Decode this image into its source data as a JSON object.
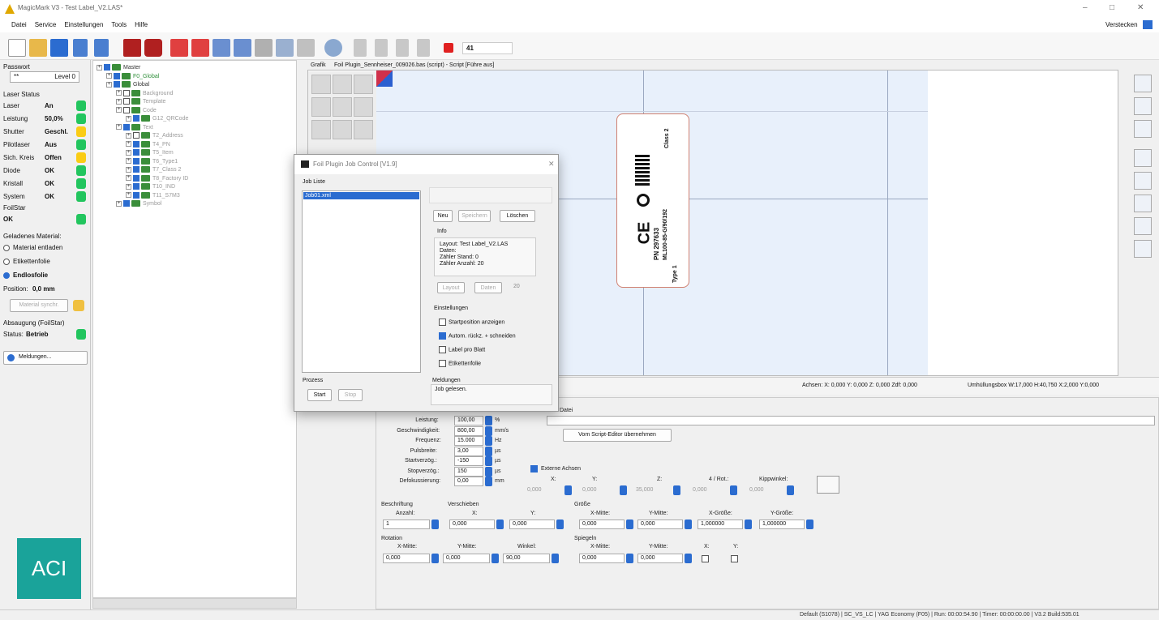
{
  "window": {
    "title": "MagicMark V3 - Test Label_V2.LAS*",
    "minimize": "–",
    "maximize": "□",
    "close": "✕"
  },
  "menu": {
    "items": [
      "Datei",
      "Service",
      "Einstellungen",
      "Tools",
      "Hilfe"
    ],
    "hide": "Verstecken"
  },
  "toolbar": {
    "counter": "41"
  },
  "left": {
    "password_label": "Passwort",
    "password_value": "**",
    "level": "Level 0",
    "laser_status_title": "Laser Status",
    "status_rows": [
      {
        "label": "Laser",
        "value": "An",
        "color": "green"
      },
      {
        "label": "Leistung",
        "value": "50,0%",
        "color": "green"
      },
      {
        "label": "Shutter",
        "value": "Geschl.",
        "color": "yellow"
      },
      {
        "label": "Pilotlaser",
        "value": "Aus",
        "color": "green"
      },
      {
        "label": "Sich. Kreis",
        "value": "Offen",
        "color": "yellow"
      },
      {
        "label": "Diode",
        "value": "OK",
        "color": "green"
      },
      {
        "label": "Kristall",
        "value": "OK",
        "color": "green"
      },
      {
        "label": "System",
        "value": "OK",
        "color": "green"
      }
    ],
    "foilstar_title": "FoilStar",
    "foilstar_value": "OK",
    "material_title": "Geladenes Material:",
    "material_options": [
      "Material entladen",
      "Etikettenfolie",
      "Endlosfolie"
    ],
    "position_label": "Position:",
    "position_value": "0,0 mm",
    "material_sync": "Material synchr.",
    "absaugung_title": "Absaugung (FoilStar)",
    "status_label": "Status:",
    "status_value": "Betrieb",
    "messages": "Meldungen...",
    "logo": "ACI"
  },
  "tree": {
    "items": [
      {
        "label": "Master",
        "indent": 0,
        "style": "normal",
        "checked": true
      },
      {
        "label": "F0_Global",
        "indent": 1,
        "style": "green",
        "checked": true
      },
      {
        "label": "Global",
        "indent": 1,
        "style": "normal",
        "checked": true
      },
      {
        "label": "Background",
        "indent": 2,
        "style": "dim",
        "checked": false
      },
      {
        "label": "Template",
        "indent": 2,
        "style": "dim",
        "checked": false
      },
      {
        "label": "Code",
        "indent": 2,
        "style": "dim",
        "checked": false
      },
      {
        "label": "G12_QRCode",
        "indent": 3,
        "style": "dim",
        "checked": true
      },
      {
        "label": "Text",
        "indent": 2,
        "style": "dim",
        "checked": true
      },
      {
        "label": "T2_Address",
        "indent": 3,
        "style": "dim",
        "checked": false
      },
      {
        "label": "T4_PN",
        "indent": 3,
        "style": "dim",
        "checked": true
      },
      {
        "label": "T5_Item",
        "indent": 3,
        "style": "dim",
        "checked": true
      },
      {
        "label": "T6_Type1",
        "indent": 3,
        "style": "dim",
        "checked": true
      },
      {
        "label": "T7_Class 2",
        "indent": 3,
        "style": "dim",
        "checked": true
      },
      {
        "label": "T8_Factory ID",
        "indent": 3,
        "style": "dim",
        "checked": true
      },
      {
        "label": "T10_IND",
        "indent": 3,
        "style": "dim",
        "checked": true
      },
      {
        "label": "T11_S7M3",
        "indent": 3,
        "style": "dim",
        "checked": true
      },
      {
        "label": "Symbol",
        "indent": 2,
        "style": "dim",
        "checked": true
      }
    ]
  },
  "canvas": {
    "tab_label": "Grafik",
    "doc_title": "Foil Plugin_Sennheiser_009026.bas (script) - Script [Führe aus]",
    "label_lines": [
      "Class 2",
      "PN 297633",
      "ML100-85-G/90/192",
      "Type 1"
    ]
  },
  "status": {
    "axes": "Achsen: X: 0,000  Y: 0,000  Z: 0,000  Zdf: 0,000",
    "bbox": "Umhüllungsbox  W:17,000  H:40,750  X:2,000  Y:0,000"
  },
  "props": {
    "params": [
      {
        "label": "Leistung:",
        "value": "100,00",
        "unit": "%"
      },
      {
        "label": "Geschwindigkeit:",
        "value": "800,00",
        "unit": "mm/s"
      },
      {
        "label": "Frequenz:",
        "value": "15.000",
        "unit": "Hz"
      },
      {
        "label": "Pulsbreite:",
        "value": "3,00",
        "unit": "µs"
      },
      {
        "label": "Startverzög.:",
        "value": "-150",
        "unit": "µs"
      },
      {
        "label": "Stopverzög.:",
        "value": "150",
        "unit": "µs"
      },
      {
        "label": "Defokussierung:",
        "value": "0,00",
        "unit": "mm"
      }
    ],
    "datei": "Datei",
    "from_script": "Vom Script-Editor übernehmen",
    "ext_axes": "Externe Achsen",
    "axes_headers": [
      "X:",
      "Y:",
      "Z:",
      "4 / Rot.:",
      "Kippwinkel:"
    ],
    "axes_values": [
      "0,000",
      "0,000",
      "35,000",
      "0,000",
      "0,000"
    ],
    "beschriftung": "Beschriftung",
    "anzahl": "Anzahl:",
    "anzahl_value": "1",
    "verschieben": "Verschieben",
    "vx": "X:",
    "vy": "Y:",
    "vx_value": "0,000",
    "vy_value": "0,000",
    "groesse": "Größe",
    "gxm": "X-Mitte:",
    "gym": "Y-Mitte:",
    "gxg": "X-Größe:",
    "gyg": "Y-Größe:",
    "gxm_v": "0,000",
    "gym_v": "0,000",
    "gxg_v": "1,000000",
    "gyg_v": "1,000000",
    "rotation": "Rotation",
    "rxm": "X-Mitte:",
    "rym": "Y-Mitte:",
    "rw": "Winkel:",
    "rxm_v": "0,000",
    "rym_v": "0,000",
    "rw_v": "90,00",
    "spiegeln": "Spiegeln",
    "sxm": "X-Mitte:",
    "sym": "Y-Mitte:",
    "sx": "X:",
    "sy": "Y:",
    "sxm_v": "0,000",
    "sym_v": "0,000"
  },
  "dialog": {
    "title": "Foil Plugin Job Control [V1.9]",
    "job_list": "Job Liste",
    "job_item": "Job01.xml",
    "neu": "Neu",
    "speichern": "Speichern",
    "loeschen": "Löschen",
    "info": "Info",
    "info_text": "Layout: Test Label_V2.LAS\nDaten:\nZähler Stand: 0\nZähler Anzahl: 20",
    "layout_btn": "Layout",
    "daten_btn": "Daten",
    "count": "20",
    "einstellungen": "Einstellungen",
    "options": [
      {
        "label": "Startposition anzeigen",
        "checked": false
      },
      {
        "label": "Autom. rückz. + schneiden",
        "checked": true
      },
      {
        "label": "Label pro Blatt",
        "checked": false
      },
      {
        "label": "Etikettenfolie",
        "checked": false
      }
    ],
    "prozess": "Prozess",
    "start": "Start",
    "stop": "Stop",
    "meldungen": "Meldungen",
    "meldung_text": "Job gelesen."
  },
  "bottom": {
    "text": "Default (S1078)  | SC_VS_LC  | YAG Economy (F05)  | Run: 00:00:54.90  | Timer: 00:00:00.00  | V3.2 Build:535.01"
  }
}
